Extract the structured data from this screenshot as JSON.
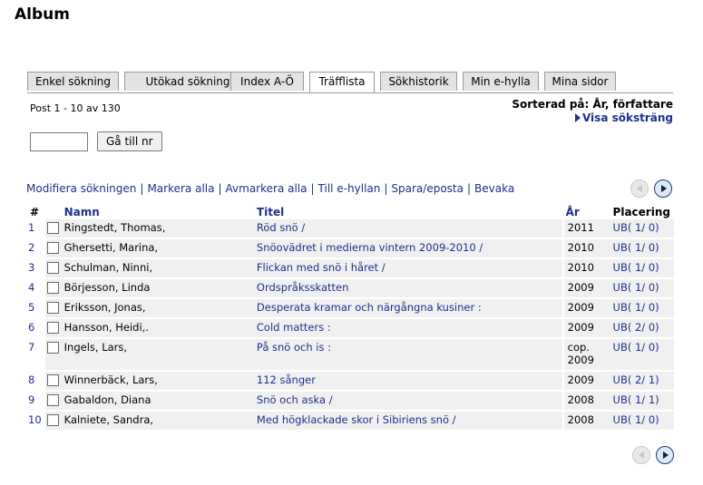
{
  "page": {
    "title": "Album"
  },
  "tabs": [
    {
      "label": "Enkel sökning",
      "active": false
    },
    {
      "label": "Utökad sökning",
      "active": false
    },
    {
      "label": "Index A-Ö",
      "active": false
    },
    {
      "label": "Träfflista",
      "active": true
    },
    {
      "label": "Sökhistorik",
      "active": false
    },
    {
      "label": "Min e-hylla",
      "active": false
    },
    {
      "label": "Mina sidor",
      "active": false
    }
  ],
  "results_info": "Post 1 - 10 av 130",
  "sort": {
    "label": "Sorterad på: År, författare",
    "show_query": "Visa söksträng"
  },
  "goto": {
    "input_value": "",
    "button_label": "Gå till nr"
  },
  "actions": [
    "Modifiera sökningen",
    "Markera alla",
    "Avmarkera alla",
    "Till e-hyllan",
    "Spara/eposta",
    "Bevaka"
  ],
  "table": {
    "headers": {
      "num": "#",
      "name": "Namn",
      "title": "Titel",
      "year": "År",
      "place": "Placering"
    },
    "rows": [
      {
        "num": "1",
        "name": "Ringstedt, Thomas,",
        "title": "Röd snö /",
        "year": "2011",
        "place": "UB( 1/ 0)"
      },
      {
        "num": "2",
        "name": "Ghersetti, Marina,",
        "title": "Snöovädret i medierna vintern 2009-2010 /",
        "year": "2010",
        "place": "UB( 1/ 0)"
      },
      {
        "num": "3",
        "name": "Schulman, Ninni,",
        "title": "Flickan med snö i håret /",
        "year": "2010",
        "place": "UB( 1/ 0)"
      },
      {
        "num": "4",
        "name": "Börjesson, Linda",
        "title": "Ordspråksskatten",
        "year": "2009",
        "place": "UB( 1/ 0)"
      },
      {
        "num": "5",
        "name": "Eriksson, Jonas,",
        "title": "Desperata kramar och närgångna kusiner :",
        "year": "2009",
        "place": "UB( 1/ 0)"
      },
      {
        "num": "6",
        "name": "Hansson, Heidi,.",
        "title": "Cold matters :",
        "year": "2009",
        "place": "UB( 2/ 0)"
      },
      {
        "num": "7",
        "name": "Ingels, Lars,",
        "title": "På snö och is :",
        "year": "cop. 2009",
        "place": "UB( 1/ 0)"
      },
      {
        "num": "8",
        "name": "Winnerbäck, Lars,",
        "title": "112 sånger",
        "year": "2009",
        "place": "UB( 2/ 1)"
      },
      {
        "num": "9",
        "name": "Gabaldon, Diana",
        "title": "Snö och aska /",
        "year": "2008",
        "place": "UB( 1/ 1)"
      },
      {
        "num": "10",
        "name": "Kalniete, Sandra,",
        "title": "Med högklackade skor i Sibiriens snö /",
        "year": "2008",
        "place": "UB( 1/ 0)"
      }
    ]
  }
}
